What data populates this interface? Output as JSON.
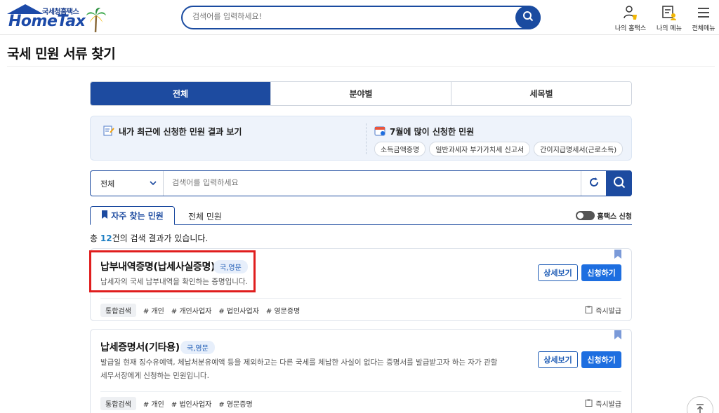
{
  "header": {
    "logo_small": "국세청홈택스",
    "logo_big": "HomeTax",
    "search_placeholder": "검색어를 입력하세요!",
    "icons": [
      {
        "label": "나의 홈택스",
        "icon": "my-hometax-icon"
      },
      {
        "label": "나의 메뉴",
        "icon": "my-menu-icon"
      },
      {
        "label": "전체메뉴",
        "icon": "hamburger-icon"
      }
    ]
  },
  "page_title": "국세 민원 서류 찾기",
  "tabs": [
    "전체",
    "분야별",
    "세목별"
  ],
  "info": {
    "left_title": "내가 최근에 신청한 민원 결과 보기",
    "right_title": "7월에 많이 신청한 민원",
    "chips": [
      "소득금액증명",
      "일반과세자 부가가치세 신고서",
      "간이지급명세서(근로소득)"
    ]
  },
  "search": {
    "select_value": "전체",
    "placeholder": "검색어를 입력하세요"
  },
  "subtabs": {
    "frequent": "자주 찾는 민원",
    "all": "전체 민원",
    "toggle_label": "홈택스 신청"
  },
  "count": {
    "prefix": "총 ",
    "number": "12",
    "suffix": "건의 검색 결과가 있습니다."
  },
  "colors": {
    "primary": "#1d4ba0",
    "apply_button": "#1d6ee0",
    "highlight": "#e01e1e"
  },
  "cards": [
    {
      "title": "납부내역증명(납세사실증명)",
      "lang": "국,영문",
      "desc": "납세자의 국세 납부내역을 확인하는 증명입니다.",
      "detail_label": "상세보기",
      "apply_label": "신청하기",
      "tags": [
        "통합검색",
        "# 개인",
        "# 개인사업자",
        "# 법인사업자",
        "# 영문증명"
      ],
      "instant": "즉시발급"
    },
    {
      "title": "납세증명서(기타용)",
      "lang": "국,영문",
      "desc1": "발급일 현재 징수유예액, 체납처분유예액 등을 제외하고는 다른 국세를 체납한 사실이 없다는 증명서를 발급받고자 하는 자가 관할",
      "desc2": "세무서장에게 신청하는 민원입니다.",
      "detail_label": "상세보기",
      "apply_label": "신청하기",
      "tags": [
        "통합검색",
        "# 개인",
        "# 법인사업자",
        "# 영문증명"
      ],
      "instant": "즉시발급"
    }
  ]
}
